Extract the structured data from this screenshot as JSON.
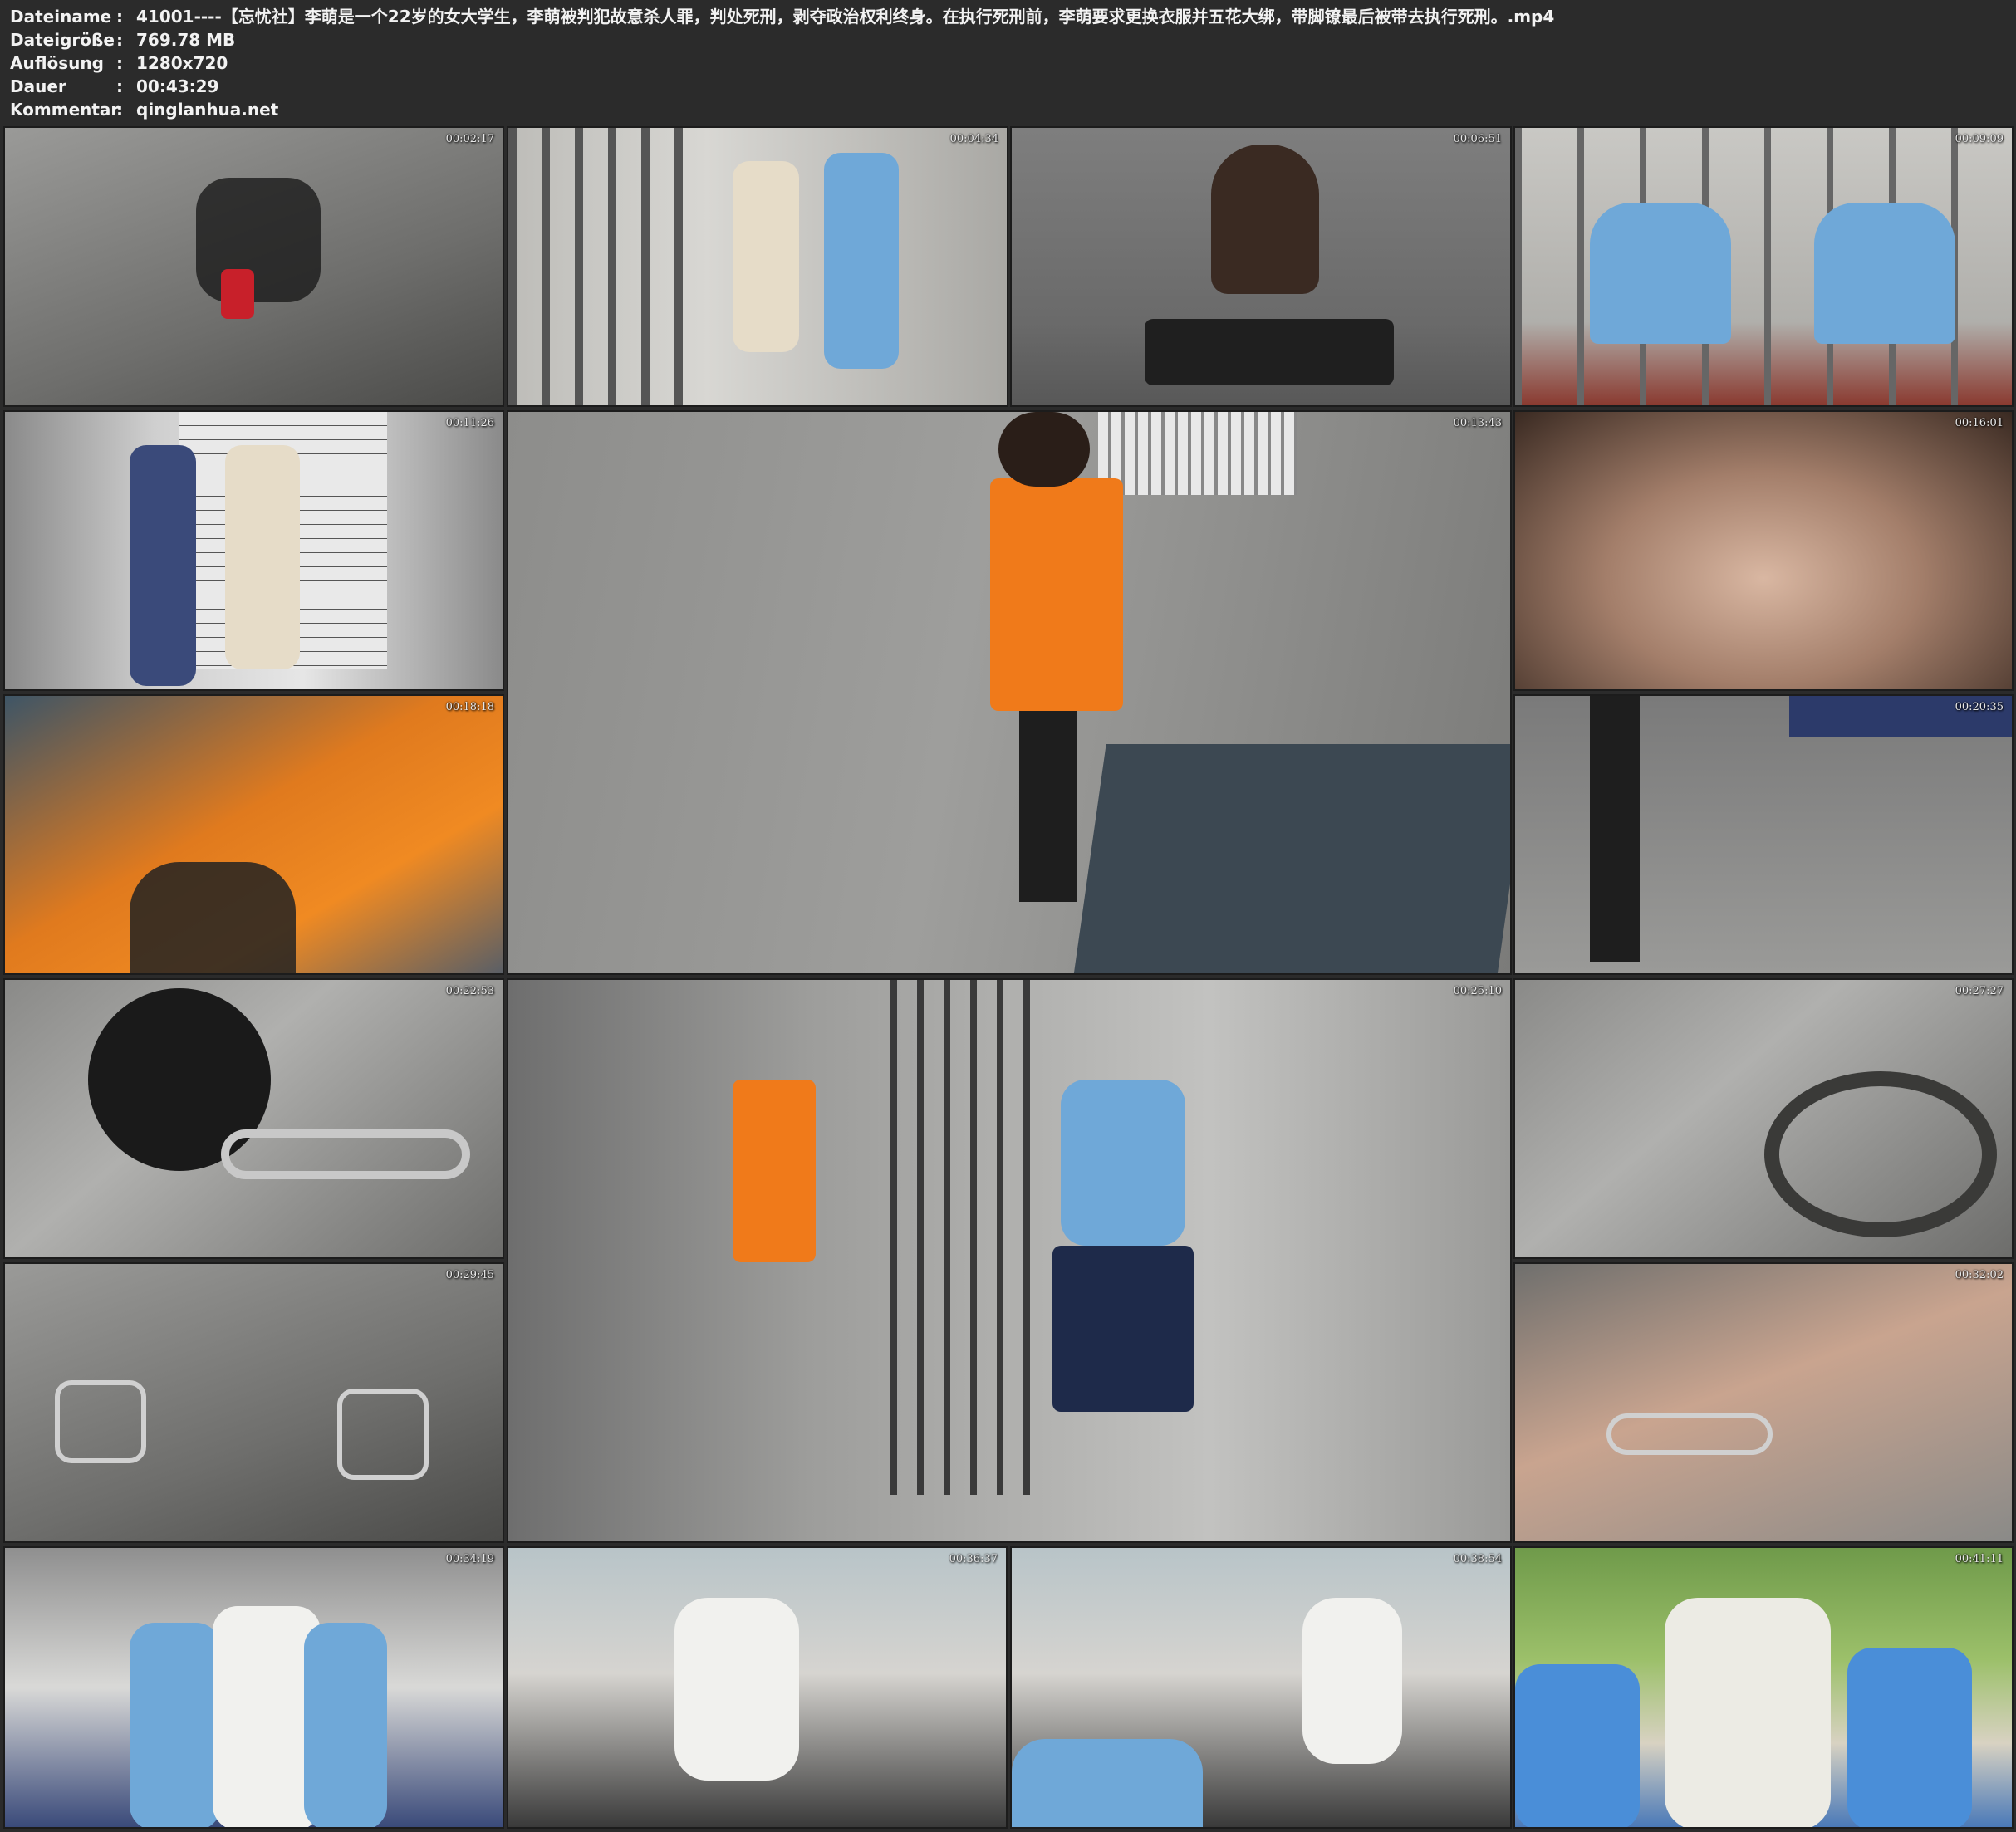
{
  "info": [
    {
      "key": "Dateiname",
      "value": "41001----【忘忧社】李萌是一个22岁的女大学生，李萌被判犯故意杀人罪，判处死刑，剥夺政治权利终身。在执行死刑前，李萌要求更换衣服并五花大绑，带脚镣最后被带去执行死刑。.mp4"
    },
    {
      "key": "Dateigröße",
      "value": "769.78 MB"
    },
    {
      "key": "Auflösung",
      "value": "1280x720"
    },
    {
      "key": "Dauer",
      "value": "00:43:29"
    },
    {
      "key": "Kommentar",
      "value": "qinglanhua.net"
    }
  ],
  "separator": ":",
  "thumbnails": [
    {
      "time": "00:02:17",
      "scene": "floor"
    },
    {
      "time": "00:04:34",
      "scene": "cell"
    },
    {
      "time": "00:06:51",
      "scene": "wall"
    },
    {
      "time": "00:09:09",
      "scene": "desk"
    },
    {
      "time": "00:11:26",
      "scene": "chart"
    },
    {
      "time": "00:13:43",
      "scene": "room"
    },
    {
      "time": "00:16:01",
      "scene": "face"
    },
    {
      "time": "00:18:18",
      "scene": "orange"
    },
    {
      "time": "00:20:35",
      "scene": "legs"
    },
    {
      "time": "00:22:53",
      "scene": "chain"
    },
    {
      "time": "00:25:10",
      "scene": "door"
    },
    {
      "time": "00:27:27",
      "scene": "chain"
    },
    {
      "time": "00:29:45",
      "scene": "floor"
    },
    {
      "time": "00:32:02",
      "scene": "hand"
    },
    {
      "time": "00:34:19",
      "scene": "group"
    },
    {
      "time": "00:36:37",
      "scene": "car"
    },
    {
      "time": "00:38:54",
      "scene": "car"
    },
    {
      "time": "00:41:11",
      "scene": "trees"
    }
  ]
}
